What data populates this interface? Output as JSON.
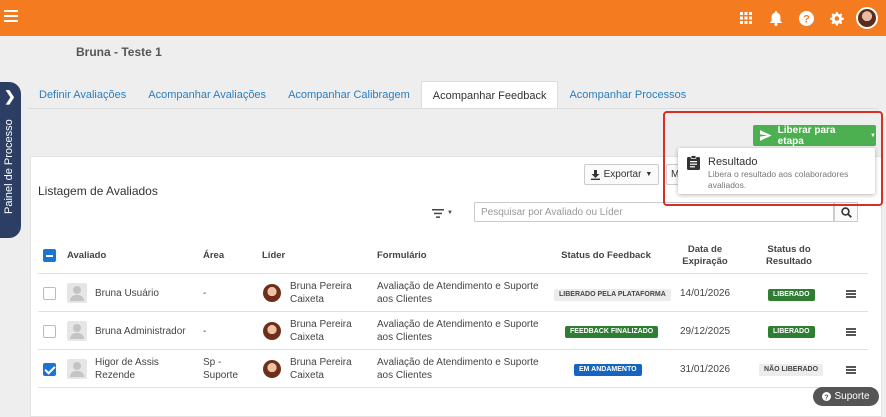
{
  "header": {
    "accent_color": "#f47b20",
    "icons": [
      "menu-icon",
      "apps-grid-icon",
      "bell-icon",
      "help-icon",
      "settings-icon",
      "avatar"
    ]
  },
  "project": {
    "title": "Bruna - Teste 1"
  },
  "side_panel": {
    "label": "Painel de Processo"
  },
  "tabs": [
    {
      "label": "Definir Avaliações",
      "active": false
    },
    {
      "label": "Acompanhar Avaliações",
      "active": false
    },
    {
      "label": "Acompanhar Calibragem",
      "active": false
    },
    {
      "label": "Acompanhar Feedback",
      "active": true
    },
    {
      "label": "Acompanhar Processos",
      "active": false
    }
  ],
  "actions": {
    "release_label": "Liberar para etapa",
    "release_color": "#4caf50",
    "dropdown": {
      "item_title": "Resultado",
      "item_desc": "Libera o resultado aos colaboradores avaliados."
    },
    "export_label": "Exportar",
    "more_label": "M"
  },
  "listing": {
    "title": "Listagem de Avaliados",
    "search_placeholder": "Pesquisar por Avaliado ou Líder"
  },
  "table": {
    "headers": {
      "evaluated": "Avaliado",
      "area": "Área",
      "leader": "Líder",
      "form": "Formulário",
      "feedback_status": "Status do Feedback",
      "expiration_l1": "Data de",
      "expiration_l2": "Expiração",
      "result_l1": "Status do",
      "result_l2": "Resultado"
    },
    "rows": [
      {
        "checked": false,
        "name_l1": "Bruna Usuário",
        "name_l2": "",
        "area_l1": "-",
        "area_l2": "",
        "leader_l1": "Bruna Pereira",
        "leader_l2": "Caixeta",
        "form_l1": "Avaliação de Atendimento e Suporte",
        "form_l2": "aos Clientes",
        "feedback_status": "LIBERADO PELA PLATAFORMA",
        "expiration": "14/01/2026",
        "result_status": "LIBERADO"
      },
      {
        "checked": false,
        "name_l1": "Bruna Administrador",
        "name_l2": "",
        "area_l1": "-",
        "area_l2": "",
        "leader_l1": "Bruna Pereira",
        "leader_l2": "Caixeta",
        "form_l1": "Avaliação de Atendimento e Suporte",
        "form_l2": "aos Clientes",
        "feedback_status": "FEEDBACK FINALIZADO",
        "expiration": "29/12/2025",
        "result_status": "LIBERADO"
      },
      {
        "checked": true,
        "name_l1": "Higor de Assis",
        "name_l2": "Rezende",
        "area_l1": "Sp -",
        "area_l2": "Suporte",
        "leader_l1": "Bruna Pereira",
        "leader_l2": "Caixeta",
        "form_l1": "Avaliação de Atendimento e Suporte",
        "form_l2": "aos Clientes",
        "feedback_status": "EM ANDAMENTO",
        "expiration": "31/01/2026",
        "result_status": "NÃO LIBERADO"
      }
    ]
  },
  "support": {
    "label": "Suporte"
  }
}
